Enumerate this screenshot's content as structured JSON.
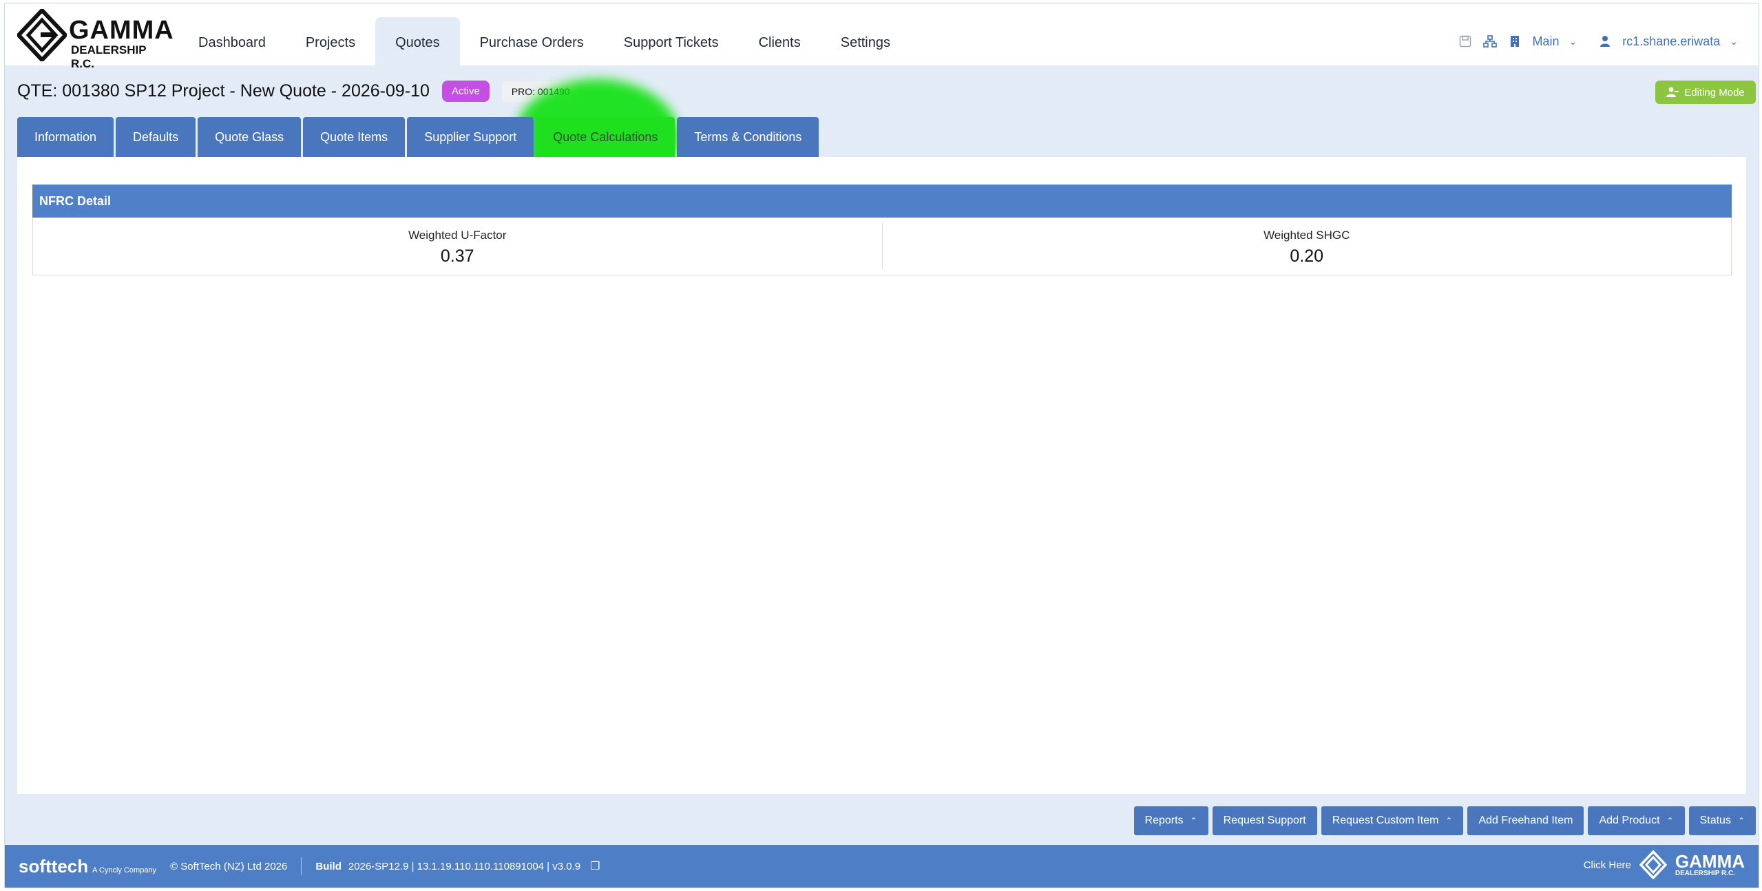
{
  "brand": {
    "name": "GAMMA",
    "sub": "DEALERSHIP R.C."
  },
  "nav": {
    "items": [
      {
        "label": "Dashboard"
      },
      {
        "label": "Projects"
      },
      {
        "label": "Quotes",
        "active": true
      },
      {
        "label": "Purchase Orders"
      },
      {
        "label": "Support Tickets"
      },
      {
        "label": "Clients"
      },
      {
        "label": "Settings"
      }
    ]
  },
  "header_right": {
    "icons": [
      "save-icon",
      "sitemap-icon",
      "building-icon"
    ],
    "branch": "Main",
    "user": "rc1.shane.eriwata"
  },
  "quote": {
    "title": "QTE: 001380 SP12 Project - New Quote - 2026-09-10",
    "status_badge": "Active",
    "project_badge": "PRO: 001490",
    "editing_mode": "Editing Mode"
  },
  "tabs": [
    {
      "label": "Information"
    },
    {
      "label": "Defaults"
    },
    {
      "label": "Quote Glass"
    },
    {
      "label": "Quote Items"
    },
    {
      "label": "Supplier Support"
    },
    {
      "label": "Quote Calculations",
      "active": true
    },
    {
      "label": "Terms & Conditions"
    }
  ],
  "nfrc": {
    "header": "NFRC Detail",
    "metrics": [
      {
        "label": "Weighted U-Factor",
        "value": "0.37"
      },
      {
        "label": "Weighted SHGC",
        "value": "0.20"
      }
    ]
  },
  "actions": {
    "reports": "Reports",
    "request_support": "Request Support",
    "request_custom_item": "Request Custom Item",
    "add_freehand_item": "Add Freehand Item",
    "add_product": "Add Product",
    "status": "Status"
  },
  "footer": {
    "brand": "softtech",
    "brand_tag": "A Cyncly Company",
    "copyright": "© SoftTech (NZ) Ltd 2026",
    "build_label": "Build",
    "build_value": "2026-SP12.9 | 13.1.19.110.110.110891004 | v3.0.9",
    "click_here": "Click Here",
    "logo_name": "GAMMA",
    "logo_sub": "DEALERSHIP R.C."
  },
  "colors": {
    "primary": "#4a76bd",
    "background": "#e3ecf6",
    "active_badge": "#c450e3",
    "editing_green": "#8cc63f",
    "highlight": "#1fe01f"
  }
}
